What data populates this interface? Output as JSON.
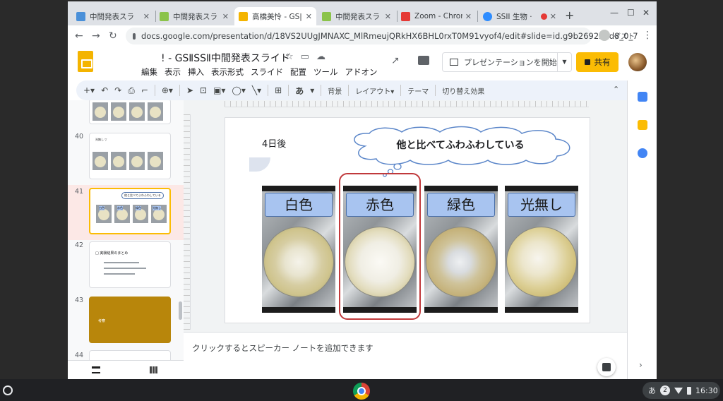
{
  "tabs": [
    {
      "label": "中間発表スラ",
      "color": "#4a90d9"
    },
    {
      "label": "中間発表スラ",
      "color": "#8bc34a"
    },
    {
      "label": "高橋美怜 - GS|",
      "color": "#f4b400"
    },
    {
      "label": "中間発表スラ",
      "color": "#8bc34a"
    },
    {
      "label": "Zoom - Chrom",
      "color": "#e53935"
    },
    {
      "label": "SSII 生物 ·",
      "color": "#2d8cff"
    }
  ],
  "address": {
    "url": "docs.google.com/presentation/d/18VS2UUgJMNAXC_MlRmeujQRkHX6BHL0rxT0M91vyof4/edit#slide=id.g9b269228d8_0_7"
  },
  "guest_label": "ゲスト",
  "app": {
    "doc_title": "! - GSⅡSSⅡ中間発表スライド",
    "menus": [
      "編集",
      "表示",
      "挿入",
      "表示形式",
      "スライド",
      "配置",
      "ツール",
      "アドオン"
    ],
    "present_label": "プレゼンテーションを開始",
    "share_label": "共有"
  },
  "toolbar": {
    "bg_label": "背景",
    "layout_label": "レイアウト▾",
    "theme_label": "テーマ",
    "transition_label": "切り替え効果",
    "font_glyph": "あ"
  },
  "filmstrip": {
    "numbers": [
      "40",
      "41",
      "42",
      "43",
      "44"
    ],
    "thumb40_title": "光無し ▽",
    "thumb41_bubble": "他と比べてふわふわしている",
    "thumb41_labels": [
      "白色",
      "赤色",
      "緑色",
      "光無し"
    ],
    "thumb42_title": "□ 実験結果のまとめ",
    "thumb43_title": "考察"
  },
  "slide": {
    "day_label": "4日後",
    "bubble_text": "他と比べてふわふわしている",
    "photos": [
      {
        "label": "白色"
      },
      {
        "label": "赤色"
      },
      {
        "label": "緑色"
      },
      {
        "label": "光無し"
      }
    ],
    "highlight_color": "#c0393b",
    "label_bg": "#a8c4f0"
  },
  "notes_placeholder": "クリックするとスピーカー ノートを追加できます",
  "shelf": {
    "ime": "あ",
    "notif_count": "2",
    "time": "16:30"
  }
}
